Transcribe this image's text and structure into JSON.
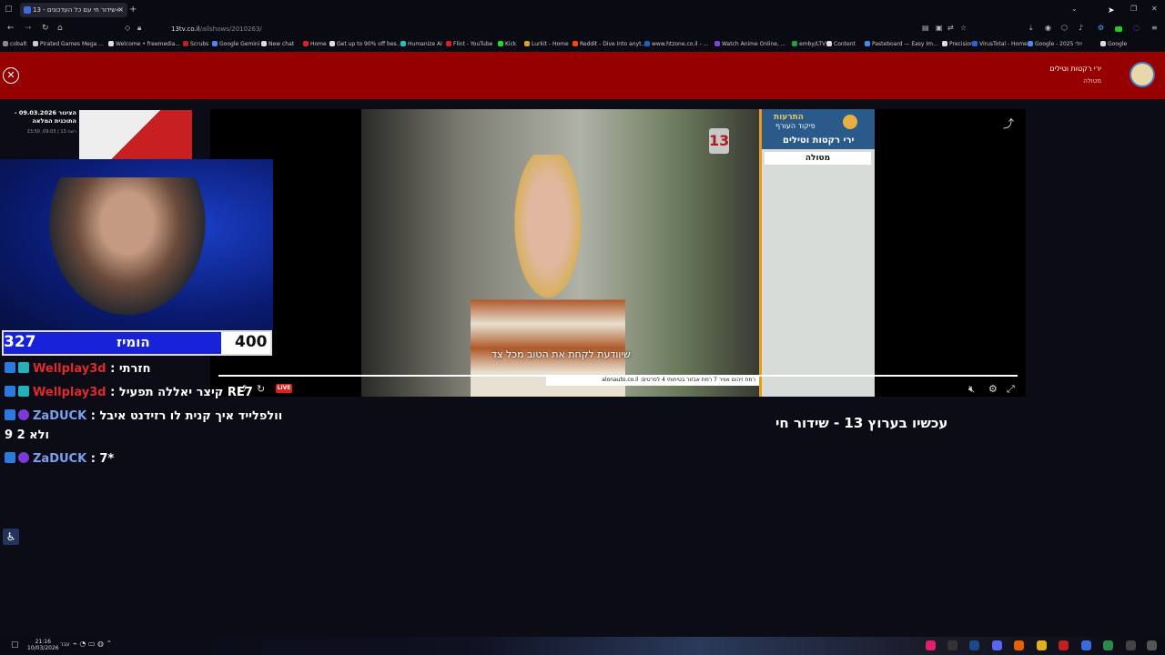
{
  "browser": {
    "tab_title": "13 - שידור חי עם כל העדכונים«",
    "tab_close": "×",
    "new_tab": "+",
    "url_domain": "13tv.co.il",
    "url_path": "/allshows/2010263/",
    "bookmarks": [
      {
        "label": "cobalt",
        "color": "#888888"
      },
      {
        "label": "Pirated Games Mega ...",
        "color": "#cccccc"
      },
      {
        "label": "Welcome • freemedia...",
        "color": "#dddddd"
      },
      {
        "label": "Scrubs",
        "color": "#c02020"
      },
      {
        "label": "Google Gemini",
        "color": "#4a8af0"
      },
      {
        "label": "New chat",
        "color": "#dddddd"
      },
      {
        "label": "Home",
        "color": "#e02020"
      },
      {
        "label": "Get up to 90% off bes...",
        "color": "#dddddd"
      },
      {
        "label": "Humanize AI",
        "color": "#20c0c0"
      },
      {
        "label": "Flint - YouTube",
        "color": "#e02020"
      },
      {
        "label": "Kick",
        "color": "#20e020"
      },
      {
        "label": "Lurkit - Home",
        "color": "#e0a020"
      },
      {
        "label": "Reddit - Dive into anyt...",
        "color": "#ff4500"
      },
      {
        "label": "www.htzone.co.il - ...",
        "color": "#2060c0"
      },
      {
        "label": "Watch Anime Online, ...",
        "color": "#8040e0"
      },
      {
        "label": "emby/LTV",
        "color": "#20a040"
      },
      {
        "label": "Content",
        "color": "#dddddd"
      },
      {
        "label": "Pasteboard — Easy Im...",
        "color": "#4a8af0"
      },
      {
        "label": "Precision",
        "color": "#dddddd"
      },
      {
        "label": "VirusTotal - Home",
        "color": "#3060e0"
      },
      {
        "label": "Google - 2025 יולי",
        "color": "#4a8af0"
      },
      {
        "label": "Google",
        "color": "#dddddd"
      }
    ]
  },
  "alert": {
    "close_icon": "⊗",
    "title": "ירי רקטות וטילים",
    "subtitle": "מטולה"
  },
  "news": {
    "title": "הצינור 09.03.2026 - התוכנית המלאה",
    "meta": "רשת 13 | 09.03, 23:50"
  },
  "score": {
    "left": "327",
    "mid": "הומיז",
    "right": "400"
  },
  "chat": [
    {
      "user": "Wellplay3d",
      "msg": ": חזרתי",
      "user_color": "red"
    },
    {
      "user": "Wellplay3d",
      "msg": ": קיצר יאללה תפעיל RE7",
      "user_color": "red"
    },
    {
      "user": "ZaDUCK",
      "msg": ": וולפלייד איך קנית לו רזידנט איבל",
      "cont": "9 ולא 2",
      "user_color": "blue"
    },
    {
      "user": "ZaDUCK",
      "msg": ": 7*",
      "user_color": "blue"
    }
  ],
  "player": {
    "channel_logo": "13",
    "subtitle": "שיוודעת לקחת את הטוב מכל צד",
    "ad_strip": "רמת זיהום אוויר 7 רמת אבזור בטיחותי 4 לפרטים: alonauto.co.il",
    "live_label": "LIVE",
    "alert_panel": {
      "header1": "התרעות",
      "header2": "פיקוד העורף",
      "title": "ירי רקטות וטילים",
      "location": "מטולה"
    }
  },
  "now_title": "עכשיו בערוץ 13 - שידור חי",
  "taskbar": {
    "time": "21:16",
    "date": "10/03/2026",
    "lang": "עבר"
  }
}
